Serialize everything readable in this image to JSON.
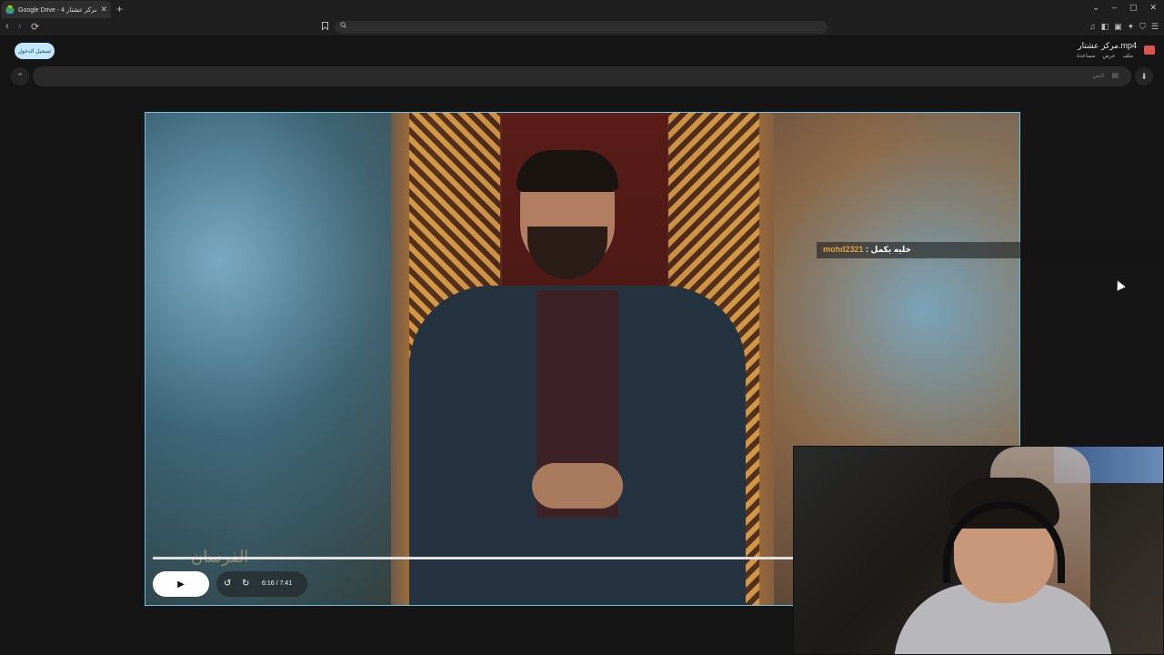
{
  "browser": {
    "tab_title": "Google Drive - مركز عشتار 4",
    "new_tab": "+",
    "tab_close": "✕",
    "window_controls": [
      "⌄",
      "–",
      "▢",
      "✕"
    ],
    "nav": {
      "back": "‹",
      "forward": "›",
      "reload": "⟳"
    },
    "bookmark_icon": "bookmark-icon",
    "search_icon_glyph": "🔍"
  },
  "drive": {
    "share_button": "تسجيل الدخول",
    "file_name": "مركز عشتار.mp4",
    "menus": [
      "ملف",
      "عرض",
      "مساعدة"
    ],
    "toolbar_search_text": "النص",
    "collapse_glyph": "⌃",
    "download_glyph": "⬇",
    "brand_color": "#d9534f",
    "accent_color": "#c2e7ff"
  },
  "video": {
    "watermark": "الفرسان",
    "current_time": "6:16",
    "duration": "7:41",
    "time_display": "6:16 / 7:41",
    "play_glyph": "▶",
    "rewind_glyph": "↺",
    "forward_glyph": "↻",
    "progress_fraction": 0.815,
    "border_color": "#68c2ea"
  },
  "chat": {
    "username": "mohd2321",
    "separator": " : ",
    "message": "خليه يكمل"
  }
}
